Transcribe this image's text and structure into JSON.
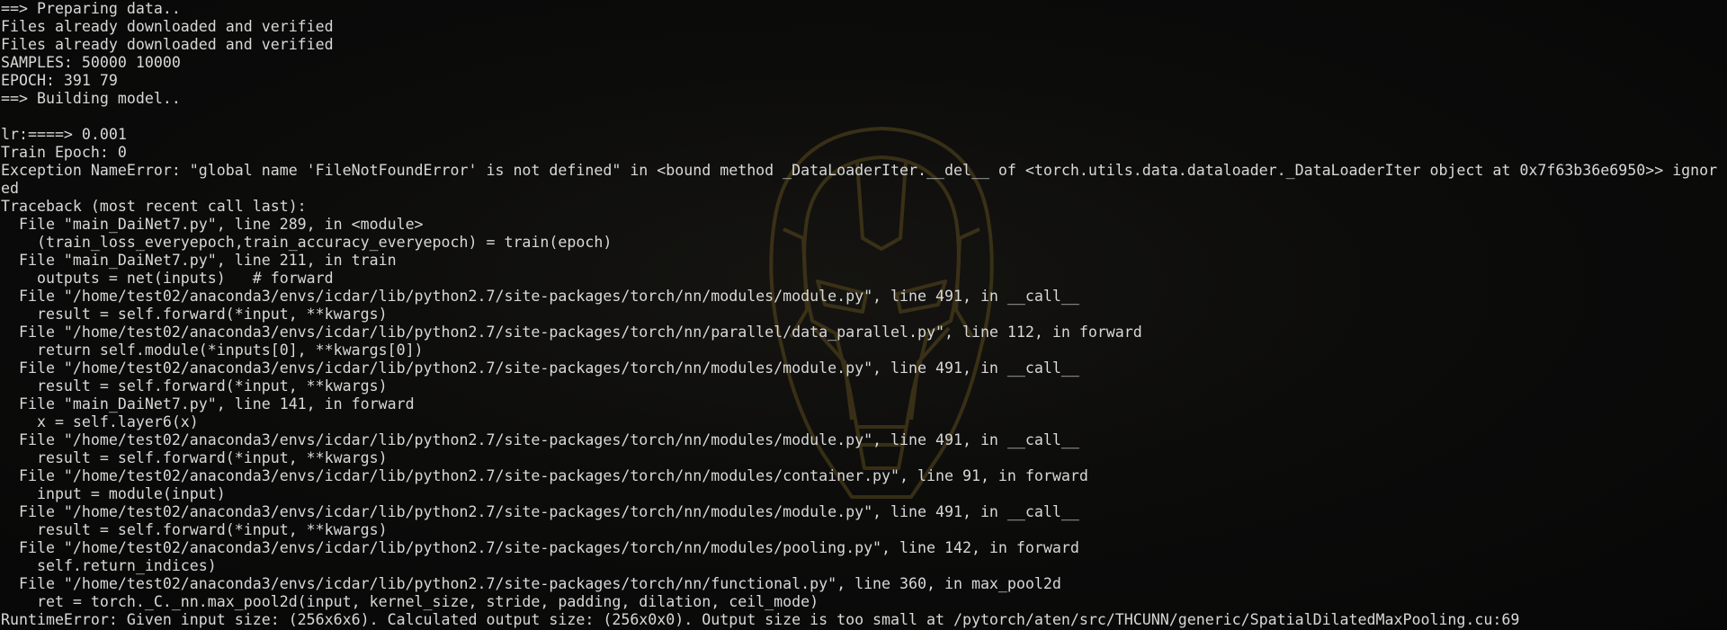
{
  "terminal": {
    "watermark_icon": "iron-man-helmet-icon",
    "colors": {
      "background": "#090909",
      "text": "#d8d8d8",
      "watermark": "#5a4a1e"
    },
    "lines": [
      "==> Preparing data..",
      "Files already downloaded and verified",
      "Files already downloaded and verified",
      "SAMPLES: 50000 10000",
      "EPOCH: 391 79",
      "==> Building model..",
      "",
      "lr:====> 0.001",
      "Train Epoch: 0",
      "Exception NameError: \"global name 'FileNotFoundError' is not defined\" in <bound method _DataLoaderIter.__del__ of <torch.utils.data.dataloader._DataLoaderIter object at 0x7f63b36e6950>> ignor",
      "ed",
      "Traceback (most recent call last):",
      "  File \"main_DaiNet7.py\", line 289, in <module>",
      "    (train_loss_everyepoch,train_accuracy_everyepoch) = train(epoch)",
      "  File \"main_DaiNet7.py\", line 211, in train",
      "    outputs = net(inputs)   # forward",
      "  File \"/home/test02/anaconda3/envs/icdar/lib/python2.7/site-packages/torch/nn/modules/module.py\", line 491, in __call__",
      "    result = self.forward(*input, **kwargs)",
      "  File \"/home/test02/anaconda3/envs/icdar/lib/python2.7/site-packages/torch/nn/parallel/data_parallel.py\", line 112, in forward",
      "    return self.module(*inputs[0], **kwargs[0])",
      "  File \"/home/test02/anaconda3/envs/icdar/lib/python2.7/site-packages/torch/nn/modules/module.py\", line 491, in __call__",
      "    result = self.forward(*input, **kwargs)",
      "  File \"main_DaiNet7.py\", line 141, in forward",
      "    x = self.layer6(x)",
      "  File \"/home/test02/anaconda3/envs/icdar/lib/python2.7/site-packages/torch/nn/modules/module.py\", line 491, in __call__",
      "    result = self.forward(*input, **kwargs)",
      "  File \"/home/test02/anaconda3/envs/icdar/lib/python2.7/site-packages/torch/nn/modules/container.py\", line 91, in forward",
      "    input = module(input)",
      "  File \"/home/test02/anaconda3/envs/icdar/lib/python2.7/site-packages/torch/nn/modules/module.py\", line 491, in __call__",
      "    result = self.forward(*input, **kwargs)",
      "  File \"/home/test02/anaconda3/envs/icdar/lib/python2.7/site-packages/torch/nn/modules/pooling.py\", line 142, in forward",
      "    self.return_indices)",
      "  File \"/home/test02/anaconda3/envs/icdar/lib/python2.7/site-packages/torch/nn/functional.py\", line 360, in max_pool2d",
      "    ret = torch._C._nn.max_pool2d(input, kernel_size, stride, padding, dilation, ceil_mode)",
      "RuntimeError: Given input size: (256x6x6). Calculated output size: (256x0x0). Output size is too small at /pytorch/aten/src/THCUNN/generic/SpatialDilatedMaxPooling.cu:69"
    ]
  }
}
